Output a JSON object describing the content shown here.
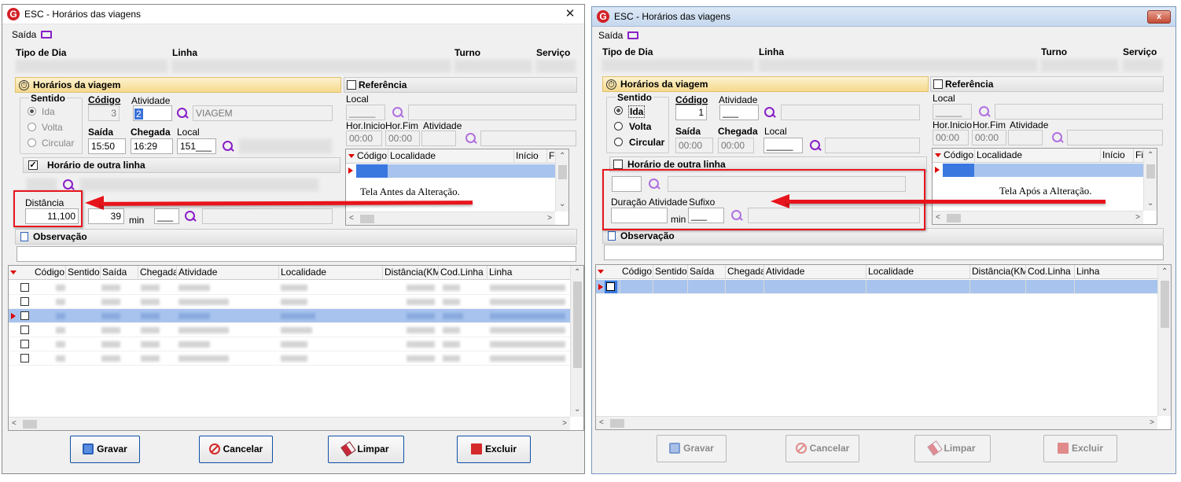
{
  "left_window": {
    "title": "ESC - Horários das viagens",
    "close_glyph": "✕",
    "menu_exit": "Saída",
    "header_labels": {
      "tipo_dia": "Tipo de Dia",
      "linha": "Linha",
      "turno": "Turno",
      "servico": "Serviço"
    },
    "horarios_section": "Horários da viagem",
    "sentido_group": "Sentido",
    "sentido_options": [
      "Ida",
      "Volta",
      "Circular"
    ],
    "codigo_label": "Código",
    "codigo_value": "3",
    "atividade_label": "Atividade",
    "atividade_value": "2",
    "atividade_desc": "VIAGEM",
    "saida_label": "Saída",
    "saida_value": "15:50",
    "chegada_label": "Chegada",
    "chegada_value": "16:29",
    "local_label": "Local",
    "local_value": "151___",
    "outra_linha_label": "Horário de outra linha",
    "distancia_label": "Distância",
    "distancia_value": "11,100",
    "duracao_value": "39",
    "min_label": "min",
    "sufixo_value": "___",
    "referencia_label": "Referência",
    "ref_local_label": "Local",
    "ref_local_value": "_____",
    "hor_inicio_label": "Hor.Inicio",
    "hor_fim_label": "Hor.Fim",
    "ref_atividade_label": "Atividade",
    "hor_inicio_value": "00:00",
    "hor_fim_value": "00:00",
    "ref_grid_headers": [
      "Código",
      "Localidade",
      "Início",
      "Fi"
    ],
    "observacao_label": "Observação",
    "grid_headers": [
      "Código",
      "Sentido",
      "Saída",
      "Chegada",
      "Atividade",
      "Localidade",
      "Distância(KM)",
      "Cod.Linha",
      "Linha"
    ],
    "buttons": {
      "gravar": "Gravar",
      "cancelar": "Cancelar",
      "limpar": "Limpar",
      "excluir": "Excluir"
    },
    "note": "Tela Antes da Alteração."
  },
  "right_window": {
    "title": "ESC - Horários das viagens",
    "close_glyph": "x",
    "menu_exit": "Saída",
    "header_labels": {
      "tipo_dia": "Tipo de Dia",
      "linha": "Linha",
      "turno": "Turno",
      "servico": "Serviço"
    },
    "horarios_section": "Horários da viagem",
    "sentido_group": "Sentido",
    "sentido_options": [
      "Ida",
      "Volta",
      "Circular"
    ],
    "codigo_label": "Código",
    "codigo_value": "1",
    "atividade_label": "Atividade",
    "atividade_value": "___",
    "saida_label": "Saída",
    "saida_value": "00:00",
    "chegada_label": "Chegada",
    "chegada_value": "00:00",
    "local_label": "Local",
    "local_value": "_____",
    "outra_linha_label": "Horário de outra linha",
    "duracao_label": "Duração Atividade",
    "sufixo_label": "Sufixo",
    "min_label": "min",
    "sufixo_value": "___",
    "referencia_label": "Referência",
    "ref_local_label": "Local",
    "ref_local_value": "_____",
    "hor_inicio_label": "Hor.Inicio",
    "hor_fim_label": "Hor.Fim",
    "ref_atividade_label": "Atividade",
    "hor_inicio_value": "00:00",
    "hor_fim_value": "00:00",
    "ref_grid_headers": [
      "Código",
      "Localidade",
      "Início",
      "Fi"
    ],
    "observacao_label": "Observação",
    "grid_headers": [
      "Código",
      "Sentido",
      "Saída",
      "Chegada",
      "Atividade",
      "Localidade",
      "Distância(KM)",
      "Cod.Linha",
      "Linha"
    ],
    "buttons": {
      "gravar": "Gravar",
      "cancelar": "Cancelar",
      "limpar": "Limpar",
      "excluir": "Excluir"
    },
    "note": "Tela Após a Alteração."
  },
  "colors": {
    "accent": "#8a1fc8",
    "annotation": "#e8141c",
    "selection": "#a8c4ee"
  }
}
